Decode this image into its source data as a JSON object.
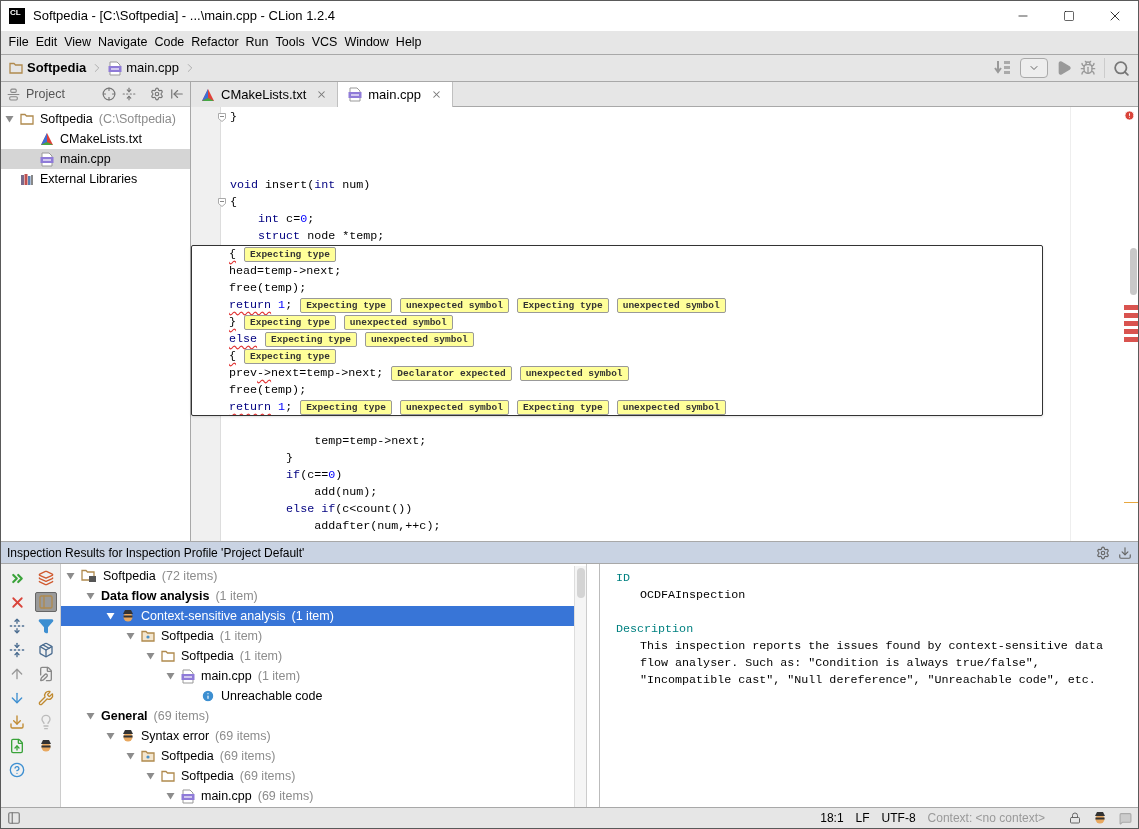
{
  "window": {
    "app_icon": "CL",
    "title": "Softpedia - [C:\\Softpedia] - ...\\main.cpp - CLion 1.2.4"
  },
  "menu": [
    "File",
    "Edit",
    "View",
    "Navigate",
    "Code",
    "Refactor",
    "Run",
    "Tools",
    "VCS",
    "Window",
    "Help"
  ],
  "breadcrumbs": [
    {
      "label": "Softpedia",
      "kind": "folder",
      "bold": true
    },
    {
      "label": "main.cpp",
      "kind": "cpp",
      "bold": false
    }
  ],
  "project_panel": {
    "title": "Project",
    "tree": [
      {
        "label": "Softpedia",
        "note": "(C:\\Softpedia)",
        "kind": "folder",
        "selected": false,
        "expanded": true,
        "children": [
          {
            "label": "CMakeLists.txt",
            "kind": "cmake",
            "selected": false
          },
          {
            "label": "main.cpp",
            "kind": "cpp",
            "selected": true
          }
        ]
      },
      {
        "label": "External Libraries",
        "kind": "library",
        "selected": false
      }
    ]
  },
  "tabs": [
    {
      "label": "CMakeLists.txt",
      "kind": "cmake",
      "selected": false
    },
    {
      "label": "main.cpp",
      "kind": "cpp",
      "selected": true
    }
  ],
  "editor": {
    "lines_above": [
      {
        "kind": "code",
        "fold": true,
        "segs": [
          {
            "text": "}",
            "kind": "plain"
          }
        ]
      },
      {
        "kind": "blank"
      },
      {
        "kind": "blank"
      },
      {
        "kind": "blank"
      },
      {
        "kind": "code",
        "fold": false,
        "segs": [
          {
            "text": "void",
            "kind": "keyword"
          },
          {
            "text": " insert(",
            "kind": "plain"
          },
          {
            "text": "int",
            "kind": "keyword"
          },
          {
            "text": " num)",
            "kind": "plain"
          }
        ]
      },
      {
        "kind": "code",
        "fold": true,
        "segs": [
          {
            "text": "{",
            "kind": "plain"
          }
        ]
      },
      {
        "kind": "code",
        "fold": false,
        "segs": [
          {
            "text": "    int",
            "kind": "keyword"
          },
          {
            "text": " c=",
            "kind": "plain"
          },
          {
            "text": "0",
            "kind": "number"
          },
          {
            "text": ";",
            "kind": "plain"
          }
        ]
      },
      {
        "kind": "code",
        "fold": false,
        "segs": [
          {
            "text": "    struct",
            "kind": "keyword"
          },
          {
            "text": " node *temp;",
            "kind": "plain"
          }
        ]
      }
    ],
    "popup": [
      {
        "segs": [
          {
            "text": "{",
            "kind": "plain",
            "squiggle": true
          }
        ],
        "tags": [
          "Expecting type"
        ]
      },
      {
        "segs": [
          {
            "text": "head=temp->next;",
            "kind": "plain",
            "squiggle": false
          }
        ]
      },
      {
        "segs": [
          {
            "text": "free(temp);",
            "kind": "plain",
            "squiggle": false
          }
        ]
      },
      {
        "segs": [
          {
            "text": "return",
            "kind": "keyword",
            "squiggle": true
          },
          {
            "text": " 1",
            "kind": "number",
            "squiggle": false
          },
          {
            "text": ";",
            "kind": "plain",
            "squiggle": false
          }
        ],
        "tags": [
          "Expecting type",
          "unexpected symbol",
          "Expecting type",
          "unexpected symbol"
        ]
      },
      {
        "segs": [
          {
            "text": "}",
            "kind": "plain",
            "squiggle": true
          }
        ],
        "tags": [
          "Expecting type",
          "unexpected symbol"
        ]
      },
      {
        "segs": [
          {
            "text": "else",
            "kind": "keyword",
            "squiggle": true
          }
        ],
        "tags": [
          "Expecting type",
          "unexpected symbol"
        ]
      },
      {
        "segs": [
          {
            "text": "{",
            "kind": "plain",
            "squiggle": true
          }
        ],
        "tags": [
          "Expecting type"
        ]
      },
      {
        "segs": [
          {
            "text": "prev",
            "kind": "plain",
            "squiggle": false
          },
          {
            "text": "->",
            "kind": "plain",
            "squiggle": true
          },
          {
            "text": "next=temp->next;",
            "kind": "plain",
            "squiggle": false
          }
        ],
        "tags": [
          "Declarator expected",
          "unexpected symbol"
        ]
      },
      {
        "segs": [
          {
            "text": "free(temp);",
            "kind": "plain",
            "squiggle": false
          }
        ]
      },
      {
        "segs": [
          {
            "text": "return",
            "kind": "keyword",
            "squiggle": true
          },
          {
            "text": " 1",
            "kind": "number",
            "squiggle": false
          },
          {
            "text": ";",
            "kind": "plain",
            "squiggle": false
          }
        ],
        "tags": [
          "Expecting type",
          "unexpected symbol",
          "Expecting type",
          "unexpected symbol"
        ]
      }
    ],
    "lines_below": [
      {
        "kind": "code",
        "segs": [
          {
            "text": "            temp=temp->next;",
            "kind": "plain"
          }
        ]
      },
      {
        "kind": "code",
        "segs": [
          {
            "text": "        }",
            "kind": "plain"
          }
        ]
      },
      {
        "kind": "code",
        "segs": [
          {
            "text": "        if",
            "kind": "keyword"
          },
          {
            "text": "(c==",
            "kind": "plain"
          },
          {
            "text": "0",
            "kind": "number"
          },
          {
            "text": ")",
            "kind": "plain"
          }
        ]
      },
      {
        "kind": "code",
        "segs": [
          {
            "text": "            add(num);",
            "kind": "plain"
          }
        ]
      },
      {
        "kind": "code",
        "segs": [
          {
            "text": "        else if",
            "kind": "keyword"
          },
          {
            "text": "(c<count())",
            "kind": "plain"
          }
        ]
      },
      {
        "kind": "code",
        "segs": [
          {
            "text": "            addafter(num,++c);",
            "kind": "plain"
          }
        ]
      }
    ]
  },
  "inspection": {
    "title": "Inspection Results for Inspection Profile 'Project Default'",
    "tools_left": [
      {
        "kind": "rerun",
        "on": false
      },
      {
        "kind": "close",
        "on": false
      },
      {
        "kind": "expand",
        "on": false
      },
      {
        "kind": "collapse",
        "on": false
      },
      {
        "kind": "up",
        "on": false
      },
      {
        "kind": "down",
        "on": false
      },
      {
        "kind": "export",
        "on": false
      },
      {
        "kind": "share",
        "on": false
      },
      {
        "kind": "help",
        "on": false
      }
    ],
    "tools_right": [
      {
        "kind": "group",
        "on": false
      },
      {
        "kind": "module",
        "on": true
      },
      {
        "kind": "filter",
        "on": false
      },
      {
        "kind": "package",
        "on": false
      },
      {
        "kind": "edit",
        "on": false
      },
      {
        "kind": "wrench",
        "on": false
      },
      {
        "kind": "bulb",
        "on": false
      },
      {
        "kind": "masked",
        "on": false
      }
    ],
    "tree": [
      {
        "label": "Softpedia",
        "count": "(72 items)",
        "bold": false,
        "kind": "module",
        "selected": false,
        "expanded": true,
        "children": [
          {
            "label": "Data flow analysis",
            "count": "(1 item)",
            "bold": true,
            "selected": false,
            "expanded": true,
            "children": [
              {
                "label": "Context-sensitive analysis",
                "count": "(1 item)",
                "bold": false,
                "kind": "masked",
                "selected": true,
                "expanded": true,
                "children": [
                  {
                    "label": "Softpedia",
                    "count": "(1 item)",
                    "bold": false,
                    "kind": "package",
                    "selected": false,
                    "expanded": true,
                    "children": [
                      {
                        "label": "Softpedia",
                        "count": "(1 item)",
                        "bold": false,
                        "kind": "folder",
                        "selected": false,
                        "expanded": true,
                        "children": [
                          {
                            "label": "main.cpp",
                            "count": "(1 item)",
                            "bold": false,
                            "kind": "cpp",
                            "selected": false,
                            "expanded": true,
                            "children": [
                              {
                                "label": "Unreachable code",
                                "bold": false,
                                "kind": "info",
                                "selected": false
                              }
                            ]
                          }
                        ]
                      }
                    ]
                  }
                ]
              }
            ]
          },
          {
            "label": "General",
            "count": "(69 items)",
            "bold": true,
            "selected": false,
            "expanded": true,
            "children": [
              {
                "label": "Syntax error",
                "count": "(69 items)",
                "bold": false,
                "kind": "masked",
                "selected": false,
                "expanded": true,
                "children": [
                  {
                    "label": "Softpedia",
                    "count": "(69 items)",
                    "bold": false,
                    "kind": "package",
                    "selected": false,
                    "expanded": true,
                    "children": [
                      {
                        "label": "Softpedia",
                        "count": "(69 items)",
                        "bold": false,
                        "kind": "folder",
                        "selected": false,
                        "expanded": true,
                        "children": [
                          {
                            "label": "main.cpp",
                            "count": "(69 items)",
                            "bold": false,
                            "kind": "cpp",
                            "selected": false,
                            "expanded": true
                          }
                        ]
                      }
                    ]
                  }
                ]
              }
            ]
          }
        ]
      }
    ],
    "details": [
      {
        "heading": "ID",
        "body": "OCDFAInspection"
      },
      {
        "heading": "Description",
        "body": "This inspection reports the issues found by context-sensitive data flow analyser. Such as: \"Condition is always true/false\", \"Incompatible cast\", \"Null dereference\", \"Unreachable code\", etc."
      }
    ]
  },
  "status_bar": {
    "position": "18:1",
    "line_sep": "LF",
    "encoding": "UTF-8",
    "context": "Context: <no context>"
  }
}
